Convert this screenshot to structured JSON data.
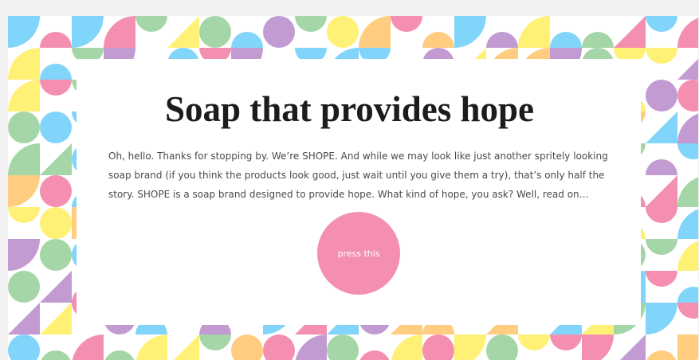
{
  "hero": {
    "headline": "Soap that provides hope",
    "intro": "Oh, hello. Thanks for stopping by. We’re SHOPE. And while we may look like just another spritely looking soap brand (if you think the products look good, just wait until you give them a try), that’s only half the story. SHOPE is a soap brand designed to provide hope. What kind of hope, you ask? Well, read on…",
    "cta_label": "press this"
  },
  "colors": {
    "cta_background": "#f48fb1",
    "pattern_palette": [
      "#f48fb1",
      "#fff176",
      "#81d4fa",
      "#a5d6a7",
      "#c39bd3",
      "#ffcc80"
    ]
  }
}
